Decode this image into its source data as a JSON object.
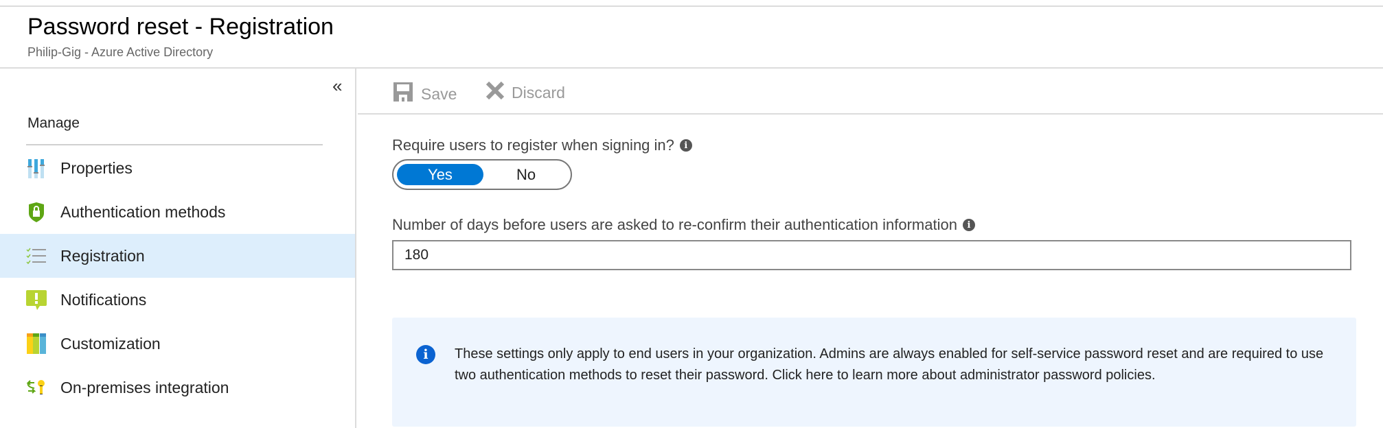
{
  "header": {
    "title": "Password reset - Registration",
    "subtitle": "Philip-Gig - Azure Active Directory"
  },
  "sidebar": {
    "collapse_icon": "«",
    "section": "Manage",
    "items": [
      {
        "label": "Properties",
        "icon": "properties-icon"
      },
      {
        "label": "Authentication methods",
        "icon": "shield-lock-icon"
      },
      {
        "label": "Registration",
        "icon": "checklist-icon",
        "selected": true
      },
      {
        "label": "Notifications",
        "icon": "notification-icon"
      },
      {
        "label": "Customization",
        "icon": "customization-icon"
      },
      {
        "label": "On-premises integration",
        "icon": "on-premises-icon"
      }
    ]
  },
  "toolbar": {
    "save_label": "Save",
    "discard_label": "Discard"
  },
  "form": {
    "require_label": "Require users to register when signing in?",
    "toggle": {
      "yes": "Yes",
      "no": "No",
      "selected": "Yes"
    },
    "days_label": "Number of days before users are asked to re-confirm their authentication information",
    "days_value": "180",
    "info_glyph": "i"
  },
  "info": {
    "text": "These settings only apply to end users in your organization. Admins are always enabled for self-service password reset and are required to use two authentication methods to reset their password. Click here to learn more about administrator password policies."
  },
  "colors": {
    "accent": "#0078d4",
    "selected_bg": "#ddeefc",
    "info_bg": "#eef5fe"
  }
}
